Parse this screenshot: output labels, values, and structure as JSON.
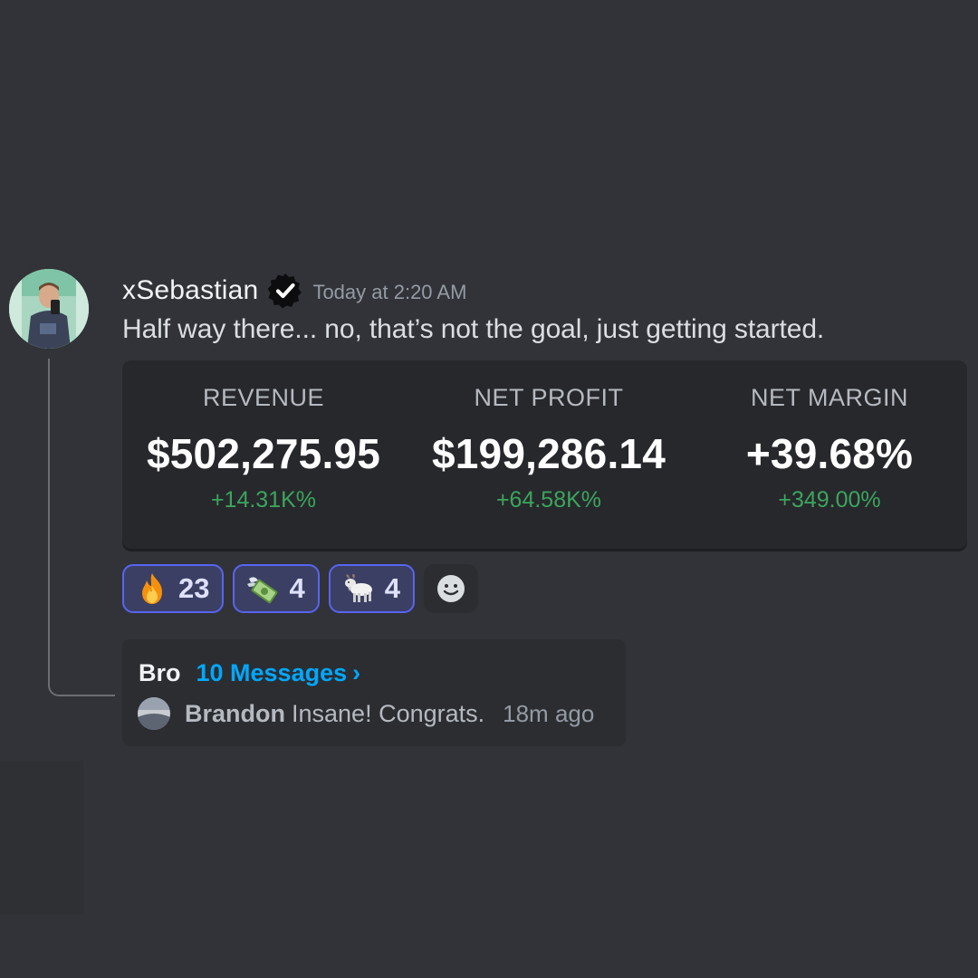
{
  "message": {
    "author": "xSebastian",
    "timestamp": "Today at 2:20 AM",
    "text": "Half way there... no, that’s not the goal, just getting started."
  },
  "stats": [
    {
      "label": "REVENUE",
      "value": "$502,275.95",
      "change": "+14.31K%"
    },
    {
      "label": "NET PROFIT",
      "value": "$199,286.14",
      "change": "+64.58K%"
    },
    {
      "label": "NET MARGIN",
      "value": "+39.68%",
      "change": "+349.00%"
    }
  ],
  "reactions": [
    {
      "emoji": "fire-emoji",
      "count": "23"
    },
    {
      "emoji": "money-with-wings-emoji",
      "count": "4"
    },
    {
      "emoji": "goat-emoji",
      "count": "4"
    }
  ],
  "thread": {
    "name": "Bro",
    "message_count": "10 Messages",
    "chevron": "›",
    "last_author": "Brandon",
    "last_text": "Insane! Congrats.",
    "last_time": "18m ago"
  },
  "colors": {
    "background": "#313338",
    "card": "#27282c",
    "positive": "#3ba55d",
    "link": "#00a8fc",
    "reaction_border": "#5865f2"
  }
}
